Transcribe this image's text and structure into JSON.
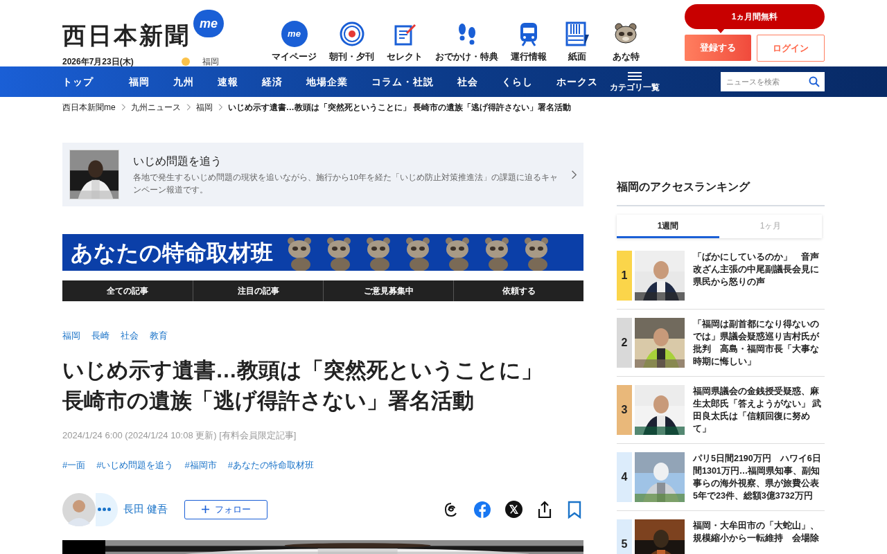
{
  "header": {
    "logo": "西日本新聞",
    "logo_badge": "me",
    "date": "2026年7月23日(木)",
    "weather_city": "福岡",
    "quick_links": [
      {
        "kind": "me",
        "badge": "me",
        "label": "マイページ"
      },
      {
        "kind": "paper",
        "label": "朝刊・夕刊"
      },
      {
        "kind": "select",
        "label": "セレクト"
      },
      {
        "kind": "steps",
        "label": "おでかけ・特典"
      },
      {
        "kind": "train",
        "label": "運行情報"
      },
      {
        "kind": "page",
        "label": "紙面"
      },
      {
        "kind": "tanuki",
        "label": "あな特"
      }
    ],
    "promo": "1ヵ月間無料",
    "register": "登録する",
    "login": "ログイン"
  },
  "nav": {
    "items": [
      "トップ",
      "福岡",
      "九州",
      "速報",
      "経済",
      "地場企業",
      "コラム・社説",
      "社会",
      "くらし",
      "ホークス"
    ],
    "menu_label": "カテゴリ一覧",
    "search": {
      "placeholder": "ニュースを検索"
    }
  },
  "breadcrumb": [
    "西日本新聞me",
    "九州ニュース",
    "福岡",
    "いじめ示す遺書…教頭は「突然死ということに」 長崎市の遺族「逃げ得許さない」署名活動"
  ],
  "series": {
    "title": "いじめ問題を追う",
    "description": "各地で発生するいじめ問題の現状を追いながら、施行から10年を経た「いじめ防止対策推進法」の課題に迫るキャンペーン報道です。"
  },
  "banner": {
    "title": "あなたの特命取材班"
  },
  "banner_tabs": [
    "全ての記事",
    "注目の記事",
    "ご意見募集中",
    "依頼する"
  ],
  "article": {
    "categories": [
      "福岡",
      "長崎",
      "社会",
      "教育"
    ],
    "title_lines": [
      "いじめ示す遺書…教頭は「突然死ということに」",
      "長崎市の遺族「逃げ得許さない」署名活動"
    ],
    "date": "2024/1/24 6:00 (2024/1/24 10:08 更新) [有料会員限定記事]",
    "tags": [
      "#一面",
      "#いじめ問題を追う",
      "#福岡市",
      "#あなたの特命取材班"
    ],
    "author": "長田 健吾",
    "follow": "フォロー",
    "share": [
      {
        "kind": "threads"
      },
      {
        "kind": "facebook"
      },
      {
        "kind": "x"
      },
      {
        "kind": "share"
      },
      {
        "kind": "bookmark"
      }
    ]
  },
  "ranking": {
    "title": "福岡のアクセスランキング",
    "tabs": [
      {
        "label": "1週間",
        "selected": true
      },
      {
        "label": "1ヶ月",
        "selected": false
      }
    ],
    "items": [
      {
        "rank": "1",
        "color": "#fbd54a",
        "title": "「ばかにしているのか」　音声改ざん主張の中尾副議長会見に県民から怒りの声"
      },
      {
        "rank": "2",
        "color": "#d9d9d9",
        "title": "「福岡は副首都になり得ないのでは」県議会疑惑巡り吉村氏が批判　高島・福岡市長「大事な時期に悔しい」"
      },
      {
        "rank": "3",
        "color": "#e9b87a",
        "title": "福岡県議会の金銭授受疑惑、麻生太郎氏「答えようがない」 武田良太氏は「信頼回復に努めて」"
      },
      {
        "rank": "4",
        "color": "#dcecfb",
        "title": "パリ5日間2190万円　ハワイ6日間1301万円…福岡県知事、副知事らの海外視察、県が旅費公表　5年で23件、総額3億3732万円"
      },
      {
        "rank": "5",
        "color": "#dcecfb",
        "title": "福岡・大牟田市の「大蛇山」、規模縮小から一転維持　会場除"
      }
    ]
  }
}
